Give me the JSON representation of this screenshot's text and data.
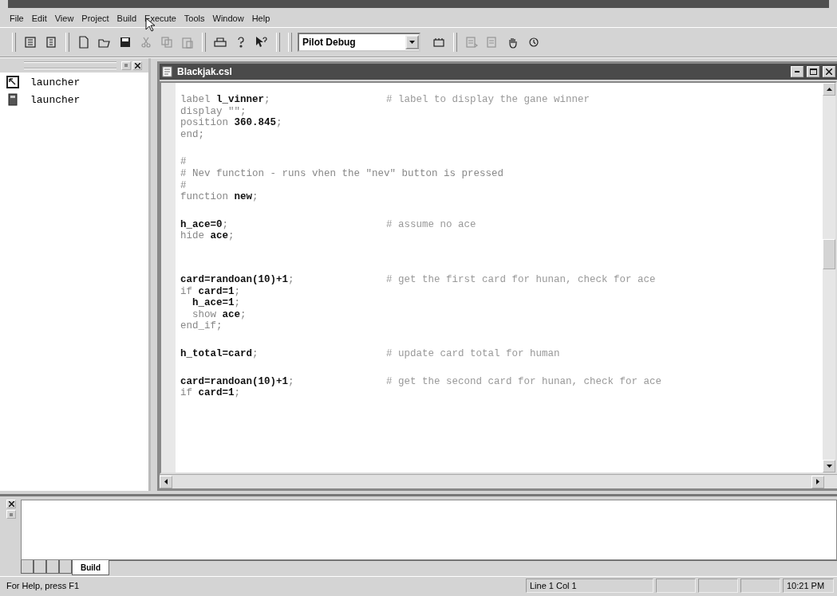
{
  "menu": [
    "File",
    "Edit",
    "View",
    "Project",
    "Build",
    "Execute",
    "Tools",
    "Window",
    "Help"
  ],
  "toolbar": {
    "buttons": [
      {
        "disabled": false
      },
      {
        "disabled": false
      },
      {
        "disabled": false
      },
      {
        "disabled": false
      },
      {
        "disabled": false
      },
      {
        "disabled": true
      },
      {
        "disabled": true
      },
      {
        "disabled": true
      },
      {
        "disabled": false
      },
      {
        "disabled": false
      },
      {
        "disabled": false
      }
    ],
    "configuration": "Pilot Debug",
    "buttons_2": [
      {
        "disabled": false
      },
      {
        "disabled": true
      },
      {
        "disabled": true
      },
      {
        "disabled": false
      },
      {
        "disabled": false
      }
    ]
  },
  "project_panel": {
    "items": [
      {
        "kind": "app",
        "label": "launcher"
      },
      {
        "kind": "file",
        "label": "launcher"
      }
    ]
  },
  "editor": {
    "title": "Blackjak.csl",
    "lines": [
      {
        "kind": "code",
        "code": "label **l_vinner**;",
        "comment": "# label to display the gane winner"
      },
      {
        "kind": "code",
        "code": "display \"\";"
      },
      {
        "kind": "code",
        "code": "position **360.845**;"
      },
      {
        "kind": "code",
        "code": "end;"
      },
      {
        "kind": "blank"
      },
      {
        "kind": "code",
        "code": "#"
      },
      {
        "kind": "code",
        "code": "# Nev function - runs vhen the \"nev\" button is pressed"
      },
      {
        "kind": "code",
        "code": "#"
      },
      {
        "kind": "code",
        "code": "function **new**;"
      },
      {
        "kind": "blank"
      },
      {
        "kind": "code",
        "code": "**h_ace=0**;",
        "comment": "# assume no ace"
      },
      {
        "kind": "code",
        "code": "hide **ace**;"
      },
      {
        "kind": "blank"
      },
      {
        "kind": "blank"
      },
      {
        "kind": "code",
        "code": "**card=randoan(10)+1**;",
        "comment": "# get the first card for hunan, check for ace"
      },
      {
        "kind": "code",
        "code": "if **card=1**;"
      },
      {
        "kind": "code",
        "code": "  **h_ace=1**;"
      },
      {
        "kind": "code",
        "code": "  show **ace**;"
      },
      {
        "kind": "code",
        "code": "end_if;"
      },
      {
        "kind": "blank"
      },
      {
        "kind": "code",
        "code": "**h_total=card**;",
        "comment": "# update card total for human"
      },
      {
        "kind": "blank"
      },
      {
        "kind": "code",
        "code": "**card=randoan(10)+1**;",
        "comment": "# get the second card for hunan, check for ace"
      },
      {
        "kind": "code",
        "code": "if **card=1**;"
      }
    ]
  },
  "output_panel": {
    "tabs": [
      {
        "selected": false
      },
      {
        "selected": false
      },
      {
        "selected": false
      },
      {
        "selected": false
      },
      {
        "label": "Build",
        "selected": true
      }
    ]
  },
  "status_bar": {
    "message": "For Help, press F1",
    "position": "Line 1 Col 1",
    "time": "10:21 PM"
  }
}
